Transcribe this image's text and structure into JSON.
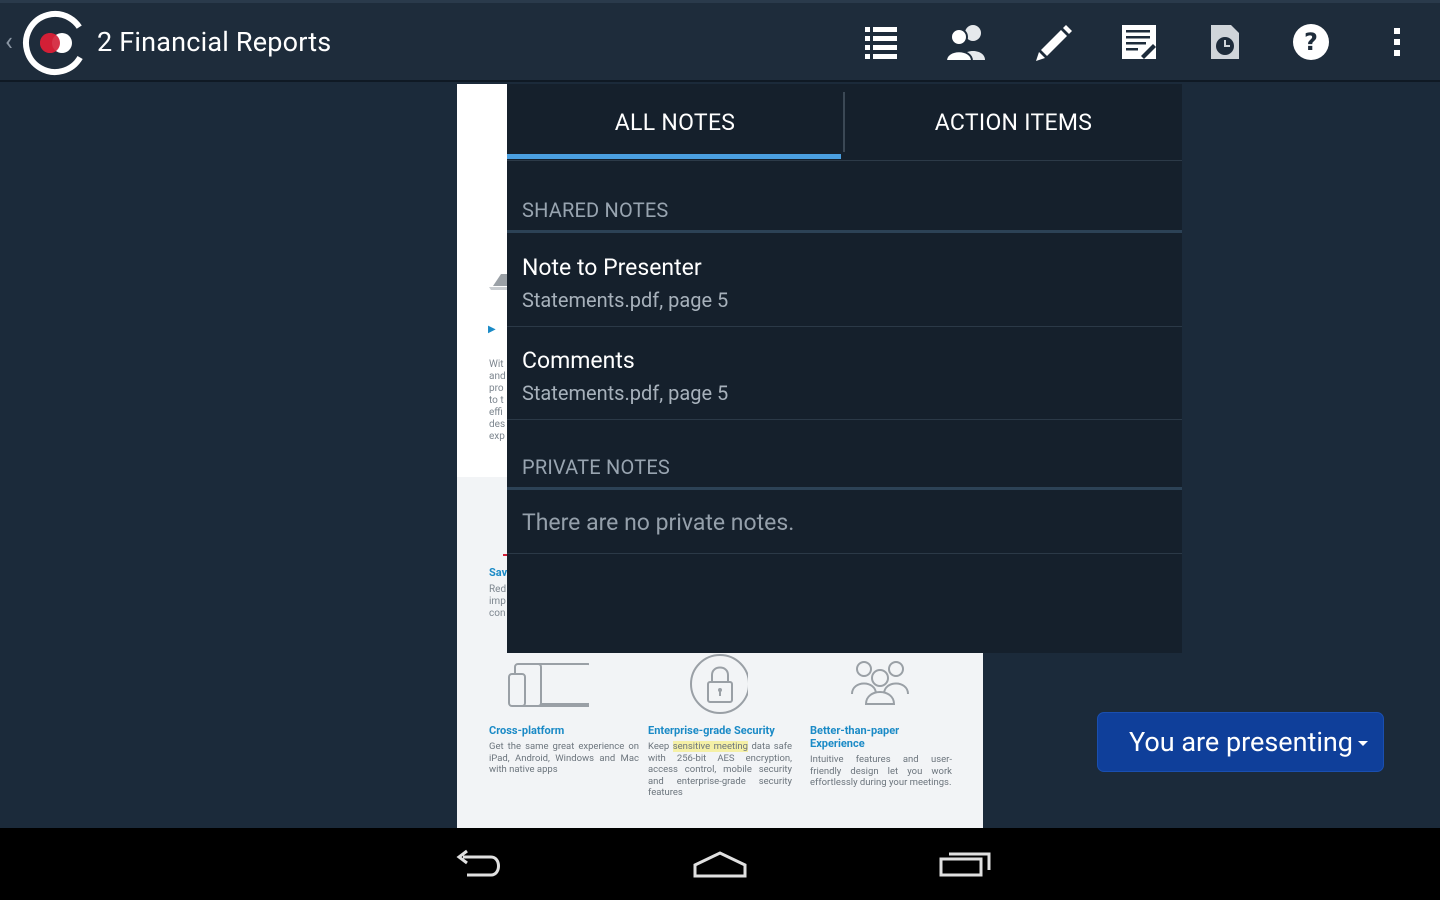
{
  "app": {
    "title": "2 Financial Reports",
    "accent": "#4a9fe0",
    "logo_color": "#d11f36"
  },
  "toolbar": {
    "icons": [
      "list-icon",
      "participants-icon",
      "pencil-icon",
      "notes-icon",
      "history-icon",
      "help-icon",
      "overflow-menu-icon"
    ]
  },
  "notes_panel": {
    "tabs": [
      {
        "label": "ALL NOTES",
        "selected": true
      },
      {
        "label": "ACTION ITEMS",
        "selected": false
      }
    ],
    "shared": {
      "heading": "SHARED NOTES",
      "items": [
        {
          "title": "Note to Presenter",
          "source": "Statements.pdf, page 5"
        },
        {
          "title": "Comments",
          "source": "Statements.pdf, page 5"
        }
      ]
    },
    "private": {
      "heading": "PRIVATE NOTES",
      "empty_text": "There are no private notes."
    }
  },
  "document": {
    "features": [
      {
        "title": "Cross-platform",
        "body": "Get the same great experience on iPad, Android, Windows and Mac with native apps"
      },
      {
        "title": "Enterprise-grade Security",
        "body_pre": "Keep ",
        "body_highlight": "sensitive meeting",
        "body_post": " data safe with 256-bit AES encryption, access control, mobile security and enterprise-grade security features"
      },
      {
        "title": "Better-than-paper Experience",
        "body": "Intuitive features and user-friendly design let you work effortlessly during your meetings."
      }
    ],
    "sliver_lines": [
      "Wit",
      "and",
      "pro",
      "to t",
      "effi",
      "des",
      "exp"
    ],
    "sliver_lines_2": [
      "Red",
      "imp",
      "con"
    ],
    "sliver_head": "Sav"
  },
  "presenting": {
    "label": "You are presenting"
  },
  "navbar": {
    "icons": [
      "back-icon",
      "home-icon",
      "recents-icon"
    ]
  }
}
